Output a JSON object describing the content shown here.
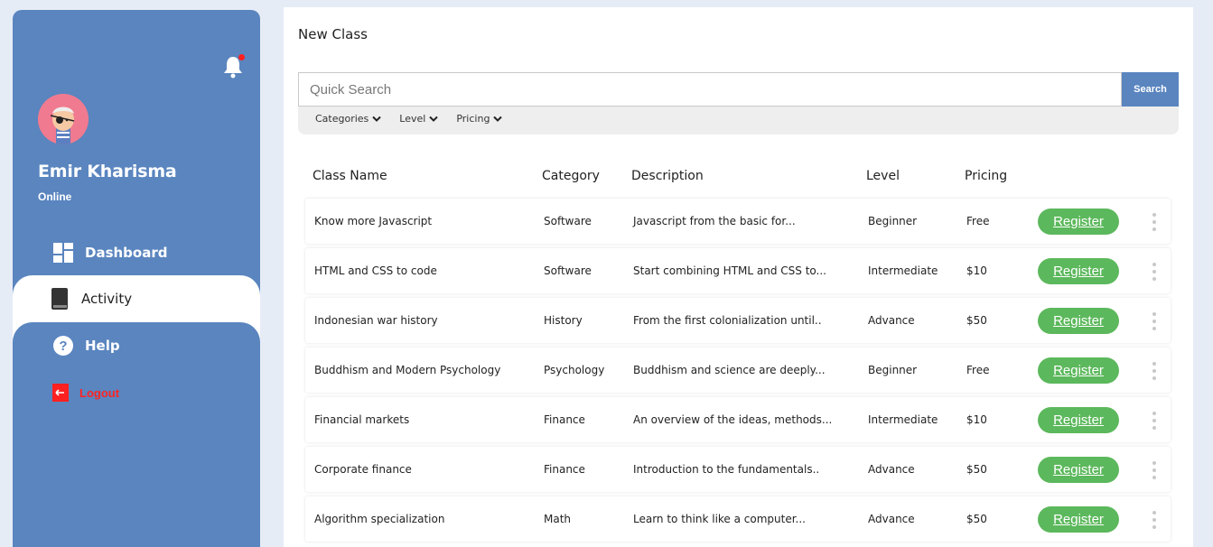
{
  "sidebar": {
    "user_name": "Emir Kharisma",
    "user_status": "Online",
    "notification_dot_color": "#ff2020",
    "nav": {
      "dashboard": "Dashboard",
      "activity": "Activity",
      "help": "Help",
      "logout": "Logout"
    },
    "icons": {
      "bell": "bell-icon",
      "dashboard": "dashboard-grid-icon",
      "activity": "book-icon",
      "help": "question-circle-icon",
      "logout": "logout-arrow-icon"
    }
  },
  "main": {
    "title": "New Class",
    "search": {
      "placeholder": "Quick Search",
      "button": "Search"
    },
    "filters": [
      "Categories",
      "Level",
      "Pricing"
    ],
    "table": {
      "headers": {
        "name": "Class Name",
        "category": "Category",
        "description": "Description",
        "level": "Level",
        "pricing": "Pricing"
      },
      "register_label": "Register",
      "rows": [
        {
          "name": "Know more Javascript",
          "category": "Software",
          "description": "Javascript from the basic for...",
          "level": "Beginner",
          "pricing": "Free"
        },
        {
          "name": "HTML and CSS to code",
          "category": "Software",
          "description": "Start combining HTML and CSS to...",
          "level": "Intermediate",
          "pricing": "$10"
        },
        {
          "name": "Indonesian war history",
          "category": "History",
          "description": "From the first colonialization until..",
          "level": "Advance",
          "pricing": "$50"
        },
        {
          "name": "Buddhism and Modern Psychology",
          "category": "Psychology",
          "description": "Buddhism and science are deeply...",
          "level": "Beginner",
          "pricing": "Free"
        },
        {
          "name": "Financial markets",
          "category": "Finance",
          "description": "An overview of the ideas, methods...",
          "level": "Intermediate",
          "pricing": "$10"
        },
        {
          "name": "Corporate finance",
          "category": "Finance",
          "description": "Introduction to the fundamentals..",
          "level": "Advance",
          "pricing": "$50"
        },
        {
          "name": "Algorithm specialization",
          "category": "Math",
          "description": "Learn to think like a computer...",
          "level": "Advance",
          "pricing": "$50"
        }
      ]
    }
  },
  "colors": {
    "sidebar": "#5a85bf",
    "register": "#5cb85c",
    "logout": "#ff2424",
    "background": "#e6ecf6"
  }
}
